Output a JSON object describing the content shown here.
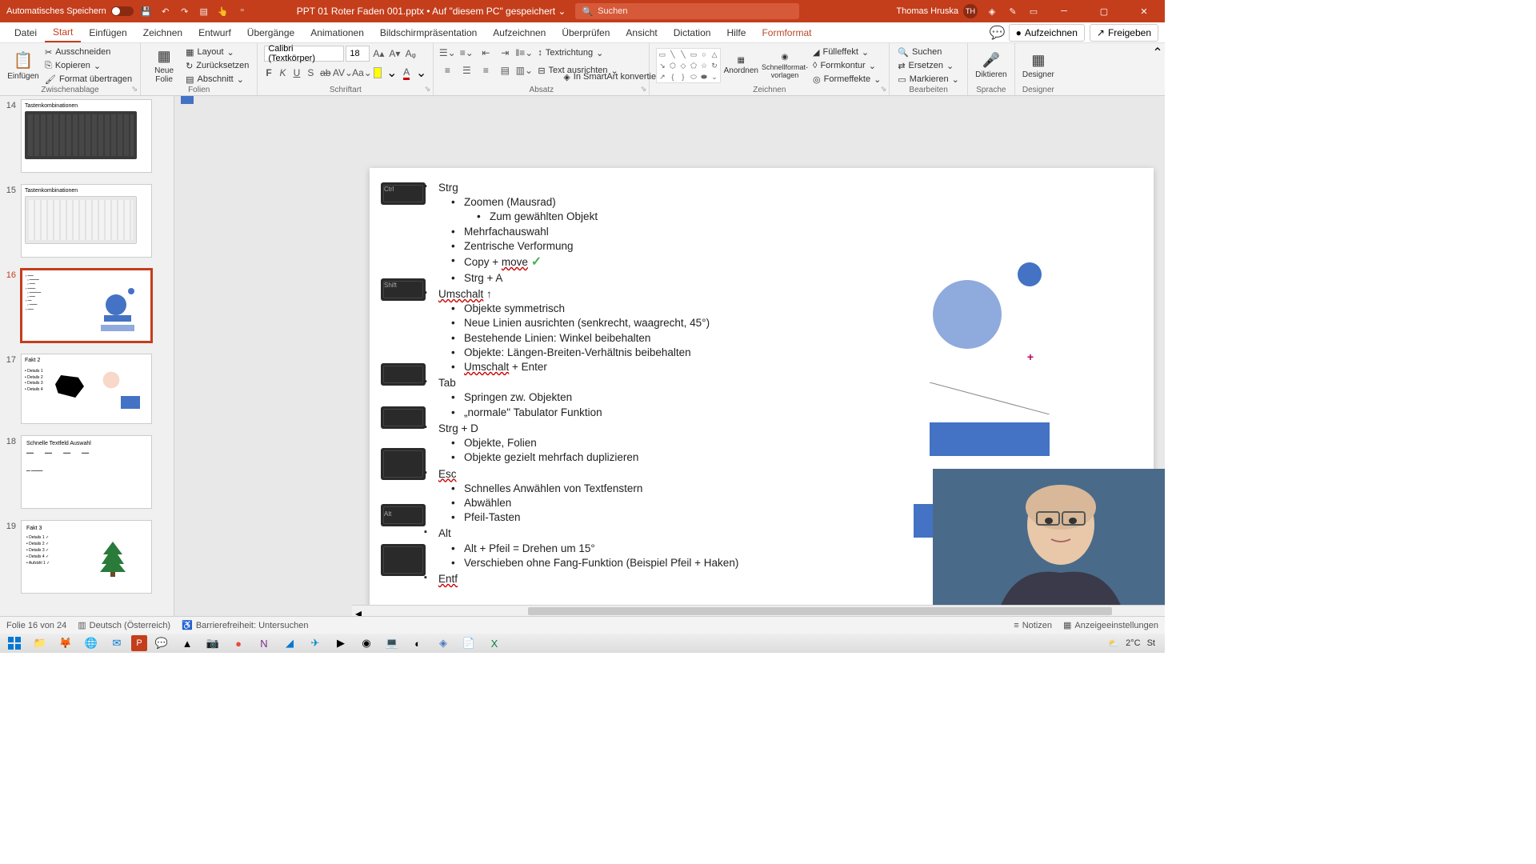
{
  "titlebar": {
    "autosave": "Automatisches Speichern",
    "filename": "PPT 01 Roter Faden 001.pptx • Auf \"diesem PC\" gespeichert ⌄",
    "search_placeholder": "Suchen",
    "user": "Thomas Hruska",
    "user_initials": "TH"
  },
  "menu": {
    "items": [
      "Datei",
      "Start",
      "Einfügen",
      "Zeichnen",
      "Entwurf",
      "Übergänge",
      "Animationen",
      "Bildschirmpräsentation",
      "Aufzeichnen",
      "Überprüfen",
      "Ansicht",
      "Dictation",
      "Hilfe",
      "Formformat"
    ],
    "active_index": 1,
    "right": {
      "aufzeichnen": "Aufzeichnen",
      "freigeben": "Freigeben"
    }
  },
  "ribbon": {
    "zwischen": {
      "label": "Zwischenablage",
      "einfuegen": "Einfügen",
      "ausschneiden": "Ausschneiden",
      "kopieren": "Kopieren",
      "format": "Format übertragen"
    },
    "folien": {
      "label": "Folien",
      "neue": "Neue\nFolie",
      "layout": "Layout",
      "zuruck": "Zurücksetzen",
      "abschnitt": "Abschnitt"
    },
    "schrift": {
      "label": "Schriftart",
      "font": "Calibri (Textkörper)",
      "size": "18"
    },
    "absatz": {
      "label": "Absatz",
      "textrichtung": "Textrichtung",
      "textausrichten": "Text ausrichten",
      "smartart": "In SmartArt konvertieren"
    },
    "zeichnen": {
      "label": "Zeichnen",
      "anordnen": "Anordnen",
      "schnell": "Schnellformat-\nvorlagen",
      "fuell": "Fülleffekt",
      "kontur": "Formkontur",
      "effekte": "Formeffekte"
    },
    "bearbeiten": {
      "label": "Bearbeiten",
      "suchen": "Suchen",
      "ersetzen": "Ersetzen",
      "markieren": "Markieren"
    },
    "sprache": {
      "label": "Sprache",
      "diktieren": "Diktieren"
    },
    "designer": {
      "label": "Designer",
      "designer": "Designer"
    }
  },
  "thumbs": [
    {
      "num": "14",
      "title": "Tastenkombinationen"
    },
    {
      "num": "15",
      "title": "Tastenkombinationen"
    },
    {
      "num": "16",
      "title": ""
    },
    {
      "num": "17",
      "title": "Fakt 2",
      "details": [
        "Details 1",
        "Details 2",
        "Details 3",
        "Details 4"
      ]
    },
    {
      "num": "18",
      "title": "Schnelle Textfeld Auswahl"
    },
    {
      "num": "19",
      "title": "Fakt 3",
      "details": [
        "Details 1",
        "Details 2",
        "Details 3",
        "Details 4",
        "Aufzähl 1"
      ]
    }
  ],
  "slide": {
    "sections": [
      {
        "head": "Strg",
        "items": [
          {
            "t": "Zoomen (Mausrad)",
            "sub": [
              "Zum gewählten Objekt"
            ]
          },
          {
            "t": "Mehrfachauswahl"
          },
          {
            "t": "Zentrische Verformung"
          },
          {
            "t": "Copy + ",
            "move": "move",
            "check": true
          },
          {
            "t": "Strg + A"
          }
        ]
      },
      {
        "head": "Umschalt",
        "head_underline": true,
        "arrow": "↑",
        "items": [
          {
            "t": "Objekte symmetrisch"
          },
          {
            "t": "Neue Linien ausrichten (senkrecht, waagrecht, 45°)"
          },
          {
            "t": "Bestehende Linien: Winkel beibehalten"
          },
          {
            "t": "Objekte: Längen-Breiten-Verhältnis beibehalten"
          },
          {
            "t_pre": "",
            "u": "Umschalt",
            "t_post": " + Enter"
          }
        ]
      },
      {
        "head": "Tab",
        "items": [
          {
            "t": "Springen zw. Objekten"
          },
          {
            "t": "„normale\" Tabulator Funktion"
          }
        ]
      },
      {
        "head": "Strg + D",
        "items": [
          {
            "t": "Objekte, Folien"
          },
          {
            "t": "Objekte gezielt mehrfach duplizieren"
          }
        ]
      },
      {
        "head": "Esc",
        "head_underline": true,
        "items": [
          {
            "t": "Schnelles Anwählen von Textfenstern"
          },
          {
            "t": "Abwählen"
          },
          {
            "t": "Pfeil-Tasten"
          }
        ]
      },
      {
        "head": "Alt",
        "items": [
          {
            "t": "Alt + Pfeil = Drehen um 15°"
          },
          {
            "t": "Verschieben ohne Fang-Funktion (Beispiel Pfeil + Haken)"
          }
        ]
      },
      {
        "head": "Entf",
        "head_underline": true,
        "items": []
      }
    ]
  },
  "status": {
    "folie": "Folie 16 von 24",
    "lang": "Deutsch (Österreich)",
    "access": "Barrierefreiheit: Untersuchen",
    "notizen": "Notizen",
    "anzeige": "Anzeigeeinstellungen"
  },
  "tray": {
    "temp": "2°C",
    "label": "St"
  }
}
